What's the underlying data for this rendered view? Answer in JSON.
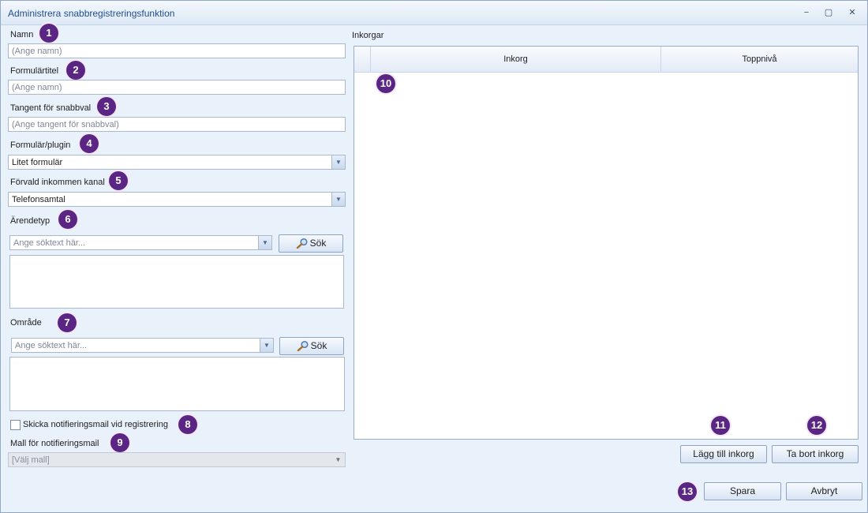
{
  "window": {
    "title": "Administrera snabbregistreringsfunktion",
    "controls": {
      "minimize": "−",
      "maximize": "▢",
      "close": "✕"
    }
  },
  "badges": [
    "1",
    "2",
    "3",
    "4",
    "5",
    "6",
    "7",
    "8",
    "9",
    "10",
    "11",
    "12",
    "13"
  ],
  "form": {
    "name": {
      "label": "Namn",
      "placeholder": "(Ange namn)"
    },
    "form_title": {
      "label": "Formulärtitel",
      "placeholder": "(Ange namn)"
    },
    "shortcut_key": {
      "label": "Tangent för snabbval",
      "placeholder": "(Ange tangent för snabbval)"
    },
    "form_plugin": {
      "label": "Formulär/plugin",
      "value": "Litet formulär"
    },
    "default_channel": {
      "label": "Förvald inkommen kanal",
      "value": "Telefonsamtal"
    },
    "case_type": {
      "label": "Ärendetyp",
      "search_placeholder": "Ange söktext här...",
      "search_button": "Sök"
    },
    "area": {
      "label": "Område",
      "search_placeholder": "Ange söktext här...",
      "search_button": "Sök"
    },
    "notify_checkbox": {
      "label": "Skicka notifieringsmail vid registrering",
      "checked": false
    },
    "mail_template": {
      "label": "Mall för notifieringsmail",
      "value": "[Välj mall]"
    }
  },
  "inboxes": {
    "label": "Inkorgar",
    "columns": [
      "Inkorg",
      "Toppnivå"
    ],
    "rows": [],
    "add_button": "Lägg till inkorg",
    "remove_button": "Ta bort inkorg"
  },
  "footer": {
    "save_button": "Spara",
    "cancel_button": "Avbryt"
  },
  "colors": {
    "badge": "#5a2583",
    "title_text": "#1f4f8f",
    "window_bg": "#e9f1fb"
  },
  "icons": {
    "search": "magnifier-icon",
    "dropdown": "chevron-down-icon"
  }
}
